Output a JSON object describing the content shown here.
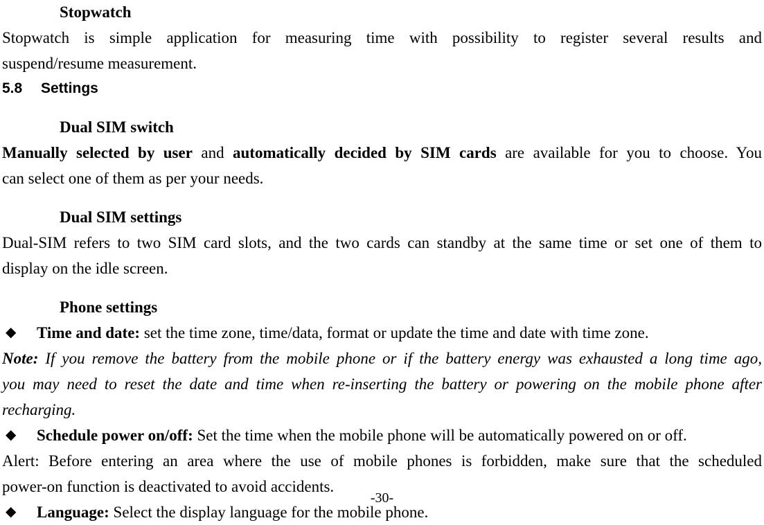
{
  "document": {
    "page_number_label": "-30-"
  },
  "stopwatch_section": {
    "heading": "Stopwatch",
    "body_line_1": "Stopwatch is simple application for measuring time with possibility to register several results and",
    "body_line_2": "suspend/resume measurement."
  },
  "settings_section": {
    "number": "5.8",
    "title": "Settings"
  },
  "dual_sim_switch": {
    "heading": "Dual SIM switch",
    "bold_part_1": "Manually selected by user",
    "plain_part_1": " and ",
    "bold_part_2": "automatically decided by SIM cards",
    "plain_part_2": " are available for you to choose. You",
    "body_line_2": "can select one of them as per your needs."
  },
  "dual_sim_settings": {
    "heading": "Dual SIM settings",
    "body_line_1": "Dual-SIM refers to two SIM card slots, and the two cards can standby at the same time or set one of them to",
    "body_line_2": "display on the idle screen."
  },
  "phone_settings": {
    "heading": "Phone settings",
    "bullets": [
      {
        "glyph": "◆",
        "term": "Time and date:",
        "description": " set the time zone, time/data, format or update the time and date with time zone."
      },
      {
        "glyph": "◆",
        "term": "Schedule power on/off:",
        "description": " Set the time when the mobile phone will be automatically powered on or off."
      },
      {
        "glyph": "◆",
        "term": "Language:",
        "description": " Select the display language for the mobile phone."
      }
    ],
    "note": {
      "label": "Note:",
      "line_1": " If you remove the battery from the mobile phone or if the battery energy was exhausted a long time ago,",
      "line_2": "you may need to reset the date and time when re-inserting the battery or powering on the mobile phone after",
      "line_3": "recharging."
    },
    "alert": {
      "line_1": "Alert: Before entering an area where the use of mobile phones is forbidden, make sure that the scheduled",
      "line_2": "power-on function is deactivated to avoid accidents."
    }
  }
}
